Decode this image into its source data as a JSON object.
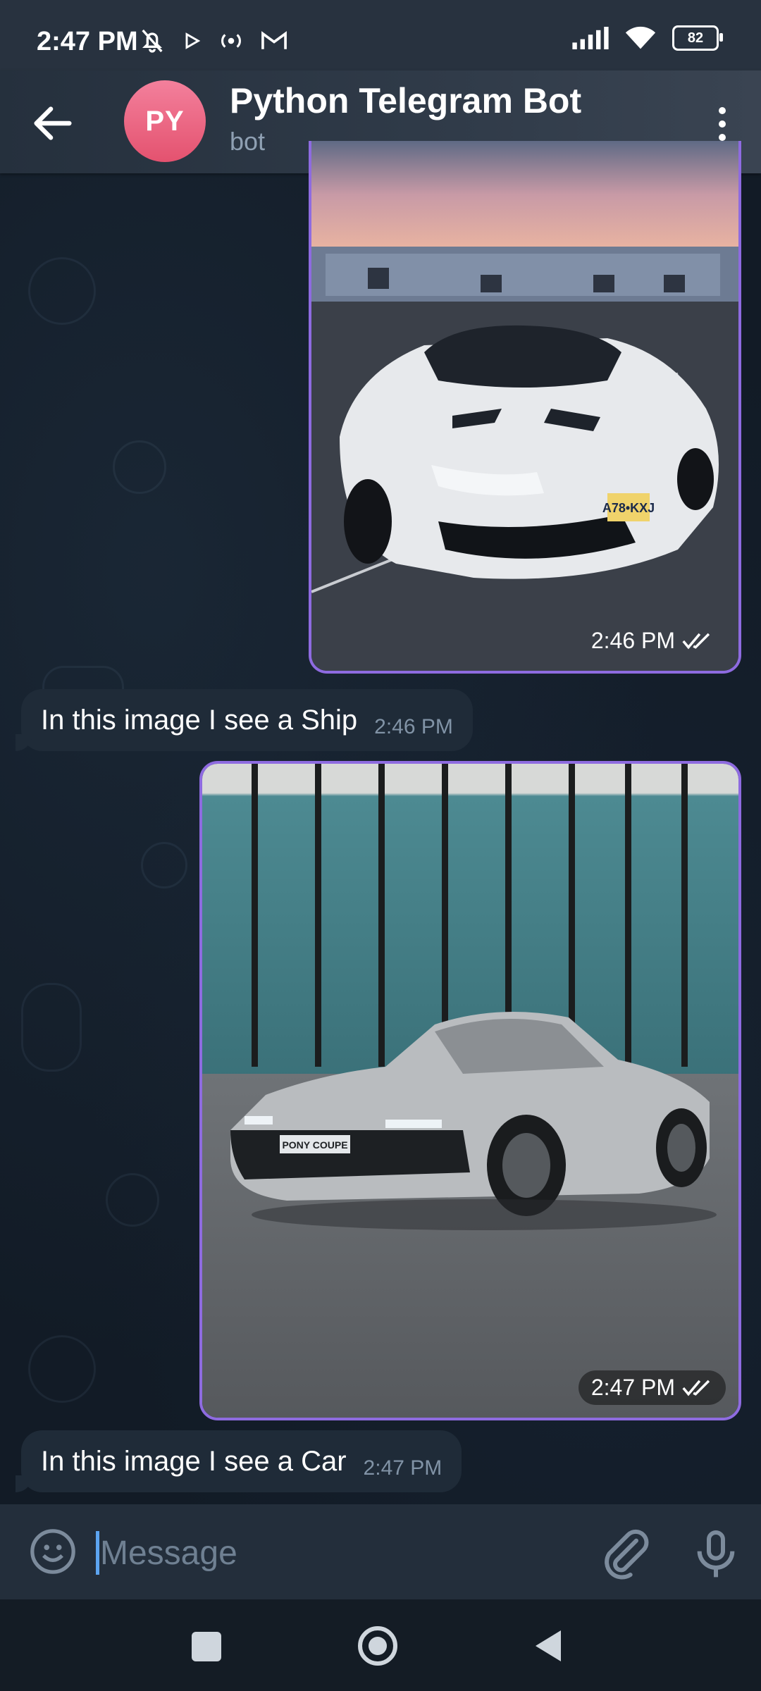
{
  "status_bar": {
    "time": "2:47 PM",
    "battery": "82",
    "icons": [
      "bell-off-icon",
      "play-icon",
      "hotspot-icon",
      "gmail-icon",
      "signal-icon",
      "wifi-icon",
      "battery-icon"
    ]
  },
  "header": {
    "avatar_initials": "PY",
    "title": "Python Telegram Bot",
    "subtitle": "bot"
  },
  "messages": [
    {
      "type": "photo",
      "direction": "out",
      "time": "2:46 PM",
      "description_icon": "white-honda-civic-photo"
    },
    {
      "type": "text",
      "direction": "in",
      "text": "In this image I see a Ship",
      "time": "2:46 PM"
    },
    {
      "type": "photo",
      "direction": "out",
      "time": "2:47 PM",
      "description_icon": "silver-pony-coupe-photo"
    },
    {
      "type": "text",
      "direction": "in",
      "text": "In this image I see a Car",
      "time": "2:47 PM"
    }
  ],
  "photo_text": {
    "plate1": "A78•KXJ",
    "plate2": "PONY COUPE"
  },
  "input": {
    "placeholder": "Message"
  },
  "colors": {
    "accent": "#8e6be0",
    "avatar": "#e85f7b",
    "bubble_in": "#1f2b38",
    "cursor": "#5ca4f0"
  }
}
